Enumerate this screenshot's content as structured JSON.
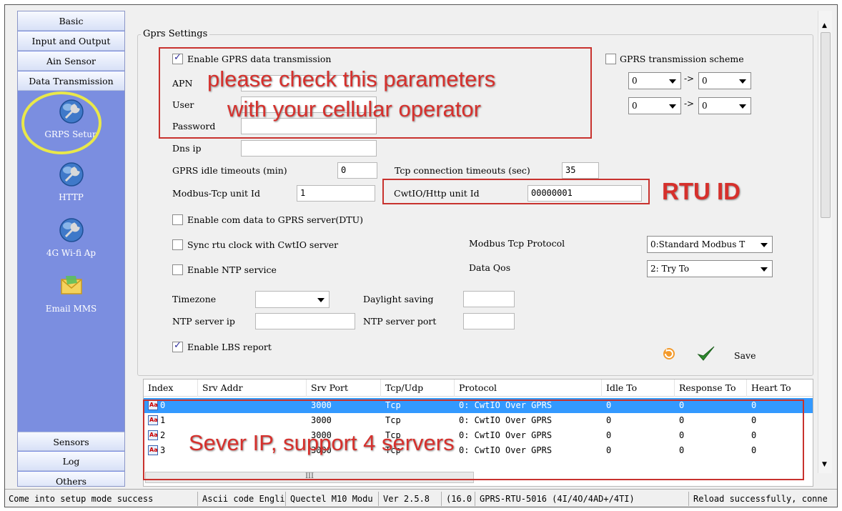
{
  "sidebar": {
    "categories_top": [
      "Basic",
      "Input and Output",
      "Ain Sensor",
      "Data Transmission"
    ],
    "items": [
      {
        "label": "GRPS Setup",
        "icon": "wrench-globe-icon"
      },
      {
        "label": "HTTP",
        "icon": "wrench-globe-icon"
      },
      {
        "label": "4G Wi-fi Ap",
        "icon": "wrench-globe-icon"
      },
      {
        "label": "Email MMS",
        "icon": "envelope-icon"
      }
    ],
    "categories_bottom": [
      "Sensors",
      "Log",
      "Others"
    ]
  },
  "gprs": {
    "title": "Gprs Settings",
    "enable_gprs_label": "Enable GPRS data transmission",
    "apn_label": "APN",
    "user_label": "User",
    "password_label": "Password",
    "dns_label": "Dns ip",
    "dns_value": "",
    "idle_label": "GPRS idle timeouts (min)",
    "idle_value": "0",
    "tcp_timeout_label": "Tcp connection timeouts (sec)",
    "tcp_timeout_value": "35",
    "modbus_unit_label": "Modbus-Tcp unit Id",
    "modbus_unit_value": "1",
    "cwt_unit_label": "CwtIO/Http unit Id",
    "cwt_unit_value": "00000001",
    "scheme_label": "GPRS transmission scheme",
    "scheme": [
      {
        "from": "0",
        "arrow": "->",
        "to": "0"
      },
      {
        "from": "0",
        "arrow": "->",
        "to": "0"
      }
    ],
    "enable_com_label": "Enable com data to GPRS server(DTU)",
    "sync_label": "Sync rtu clock with CwtIO server",
    "ntp_label": "Enable NTP service",
    "modbus_protocol_label": "Modbus Tcp Protocol",
    "modbus_protocol_value": "0:Standard Modbus T",
    "data_qos_label": "Data Qos",
    "data_qos_value": "2: Try To",
    "timezone_label": "Timezone",
    "timezone_value": "",
    "daylight_label": "Daylight saving",
    "ntp_ip_label": "NTP server ip",
    "ntp_port_label": "NTP server port",
    "lbs_label": "Enable LBS report",
    "save_label": "Save"
  },
  "annotations": {
    "params_line1": "please check this parameters",
    "params_line2": "with your cellular operator",
    "rtu_id": "RTU ID",
    "server_ip": "Sever IP, support 4 servers"
  },
  "table": {
    "headers": [
      "Index",
      "Srv Addr",
      "Srv Port",
      "Tcp/Udp",
      "Protocol",
      "Idle To",
      "Response To",
      "Heart To"
    ],
    "rows": [
      {
        "index": "0",
        "addr": "",
        "port": "3000",
        "proto": "Tcp",
        "protocol": "0: CwtIO Over GPRS",
        "idle": "0",
        "resp": "0",
        "heart": "0"
      },
      {
        "index": "1",
        "addr": "",
        "port": "3000",
        "proto": "Tcp",
        "protocol": "0: CwtIO Over GPRS",
        "idle": "0",
        "resp": "0",
        "heart": "0"
      },
      {
        "index": "2",
        "addr": "",
        "port": "3000",
        "proto": "Tcp",
        "protocol": "0: CwtIO Over GPRS",
        "idle": "0",
        "resp": "0",
        "heart": "0"
      },
      {
        "index": "3",
        "addr": "",
        "port": "3000",
        "proto": "Tcp",
        "protocol": "0: CwtIO Over GPRS",
        "idle": "0",
        "resp": "0",
        "heart": "0"
      }
    ],
    "scroll_label": "III"
  },
  "status": [
    "Come into setup mode success",
    "Ascii code Engli",
    "Quectel M10 Modu",
    "Ver 2.5.8",
    "(16.0",
    "GPRS-RTU-5016 (4I/4O/4AD+/4TI)",
    "Reload successfully, conne"
  ],
  "colors": {
    "sidebar": "#7b8ee0",
    "annotation_red": "#c8322e",
    "selection": "#3399ff",
    "highlight_circle": "#e9e84a"
  }
}
